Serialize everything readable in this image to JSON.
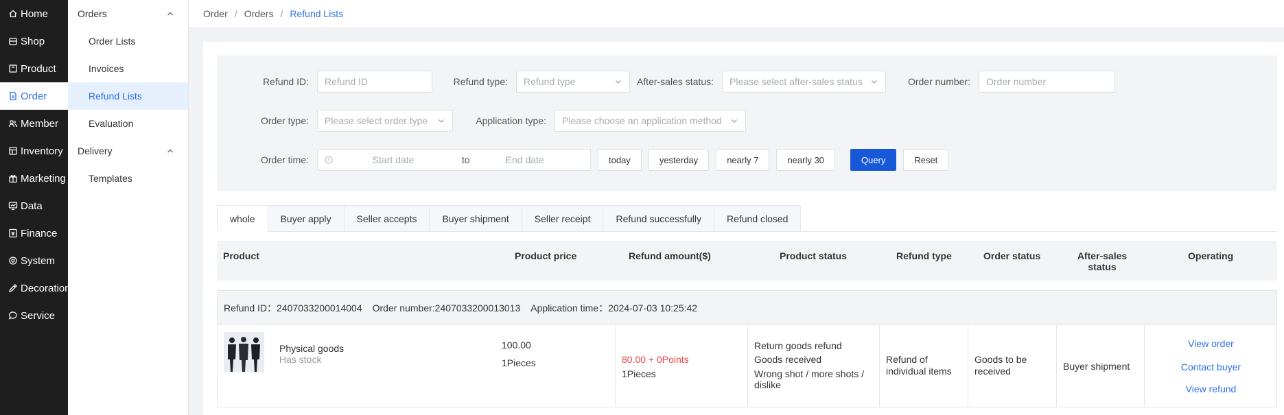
{
  "sidebar": {
    "items": [
      {
        "label": "Home",
        "icon": "home-icon"
      },
      {
        "label": "Shop",
        "icon": "shop-icon"
      },
      {
        "label": "Product",
        "icon": "product-icon"
      },
      {
        "label": "Order",
        "icon": "order-icon",
        "active": true
      },
      {
        "label": "Member",
        "icon": "member-icon"
      },
      {
        "label": "Inventory",
        "icon": "inventory-icon"
      },
      {
        "label": "Marketing",
        "icon": "marketing-icon"
      },
      {
        "label": "Data",
        "icon": "data-icon"
      },
      {
        "label": "Finance",
        "icon": "finance-icon"
      },
      {
        "label": "System",
        "icon": "system-icon"
      },
      {
        "label": "Decoration",
        "icon": "decoration-icon"
      },
      {
        "label": "Service",
        "icon": "service-icon"
      }
    ]
  },
  "subnav": {
    "orders_group": "Orders",
    "order_lists": "Order Lists",
    "invoices": "Invoices",
    "refund_lists": "Refund Lists",
    "evaluation": "Evaluation",
    "delivery_group": "Delivery",
    "templates": "Templates"
  },
  "breadcrumb": {
    "items": [
      "Order",
      "Orders",
      "Refund Lists"
    ],
    "separator": "/"
  },
  "filters": {
    "refund_id": {
      "label": "Refund ID:",
      "placeholder": "Refund ID"
    },
    "refund_type": {
      "label": "Refund type:",
      "placeholder": "Refund type"
    },
    "after_sales_status": {
      "label": "After-sales status:",
      "placeholder": "Please select after-sales status"
    },
    "order_number": {
      "label": "Order number:",
      "placeholder": "Order number"
    },
    "order_type": {
      "label": "Order type:",
      "placeholder": "Please select order type"
    },
    "application_type": {
      "label": "Application type:",
      "placeholder": "Please choose an application method"
    },
    "order_time": {
      "label": "Order time:",
      "start_placeholder": "Start date",
      "to": "to",
      "end_placeholder": "End date"
    },
    "quick": {
      "today": "today",
      "yesterday": "yesterday",
      "nearly7": "nearly 7",
      "nearly30": "nearly 30"
    },
    "query": "Query",
    "reset": "Reset"
  },
  "tabs": [
    "whole",
    "Buyer apply",
    "Seller accepts",
    "Buyer shipment",
    "Seller receipt",
    "Refund successfully",
    "Refund closed"
  ],
  "table": {
    "headers": {
      "product": "Product",
      "price": "Product price",
      "amount": "Refund amount($)",
      "product_status": "Product status",
      "refund_type": "Refund type",
      "order_status": "Order status",
      "after_sales": "After-sales status",
      "operating": "Operating"
    },
    "rows": [
      {
        "refund_id_label": "Refund ID：",
        "refund_id": "2407033200014004",
        "order_number_label": "Order number:",
        "order_number": "2407033200013013",
        "application_time_label": "Application time：",
        "application_time": "2024-07-03 10:25:42",
        "product_name": "Physical goods",
        "stock": "Has stock",
        "price": "100.00",
        "quantity": "1Pieces",
        "refund_amount": "80.00 + 0Points",
        "refund_quantity": "1Pieces",
        "status_lines": [
          "Return goods refund",
          "Goods received",
          "Wrong shot / more shots / dislike"
        ],
        "refund_type": "Refund of individual items",
        "order_status": "Goods to be received",
        "after_sales_status": "Buyer shipment",
        "actions": [
          "View order",
          "Contact buyer",
          "View refund"
        ]
      }
    ]
  },
  "colors": {
    "accent": "#2d6fe8",
    "primary_button": "#1658d8",
    "sidebar_bg": "#1e1e1e",
    "refund_red": "#e94545"
  }
}
